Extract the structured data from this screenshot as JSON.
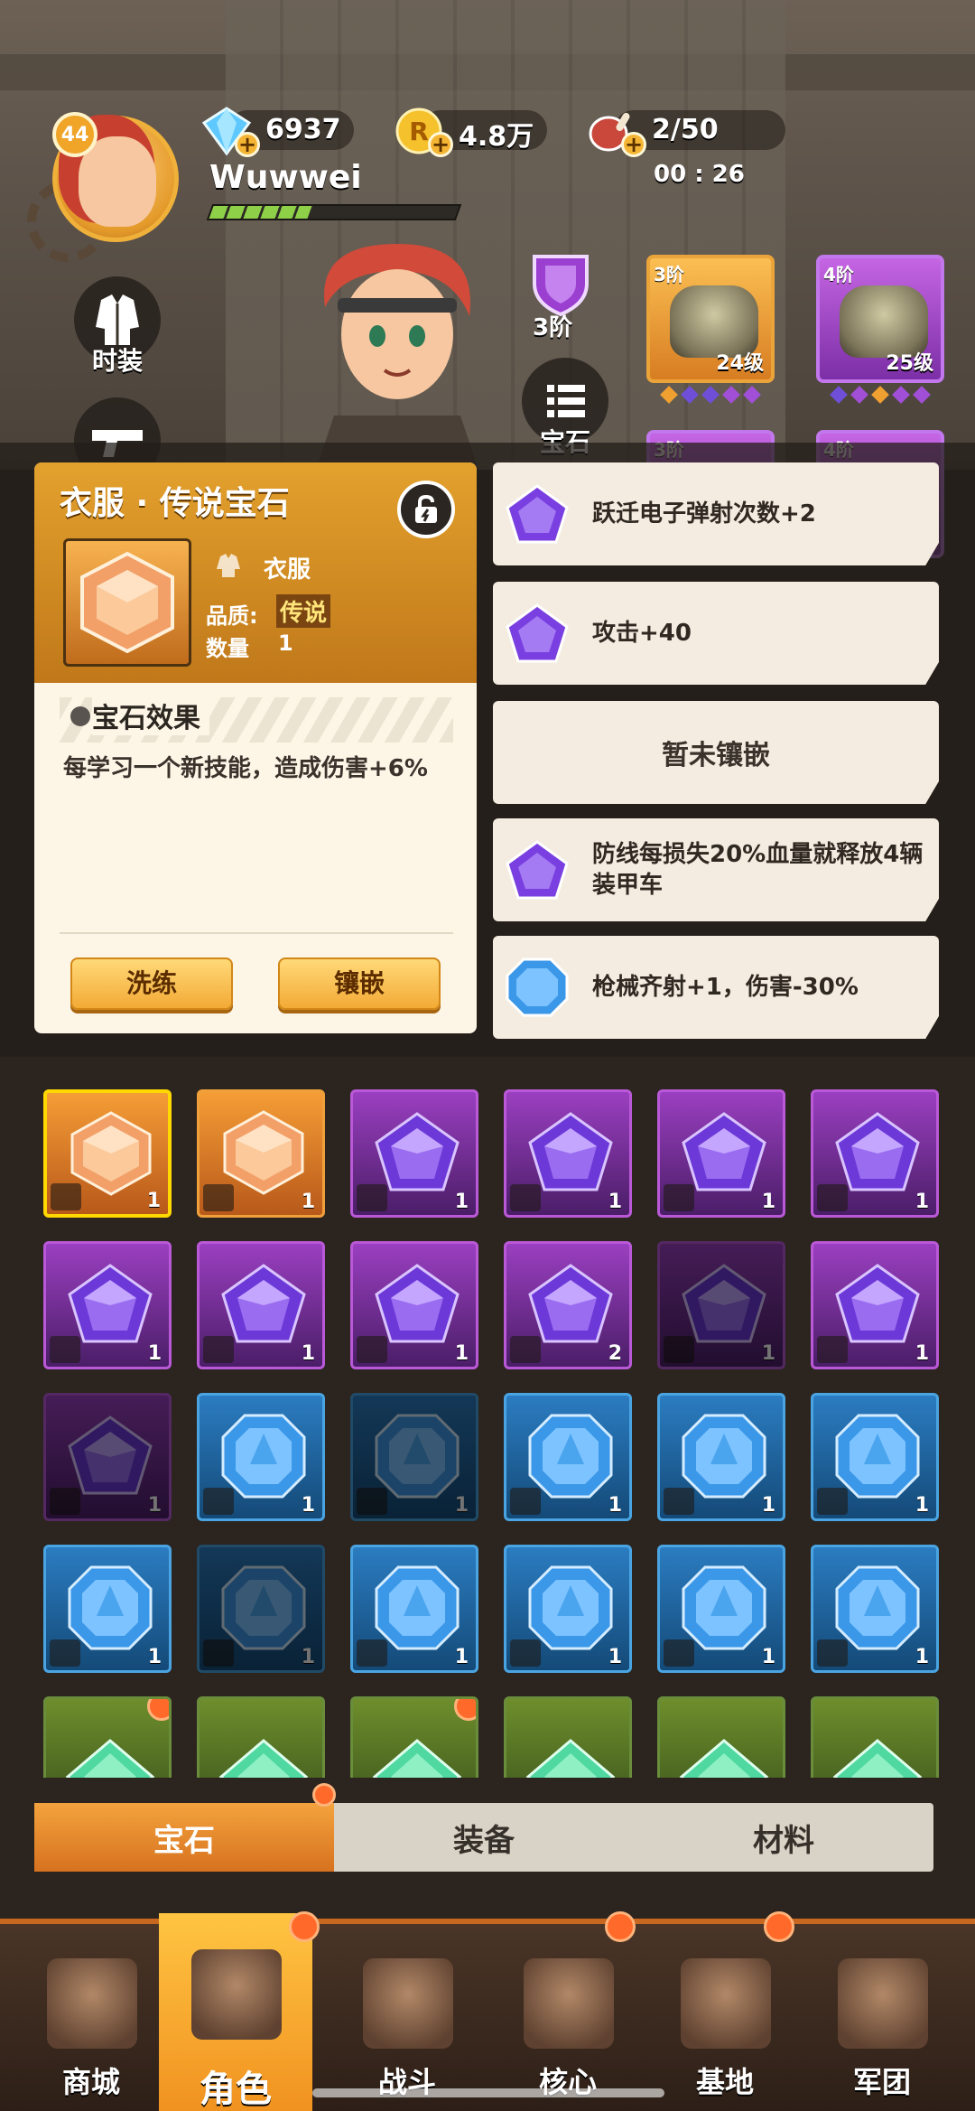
{
  "player": {
    "level": "44",
    "name": "Wuwwei",
    "xp_fraction": 0.4
  },
  "resources": {
    "diamonds": "6937",
    "coins": "4.8万",
    "stamina": "2/50",
    "stamina_timer": "00 : 26"
  },
  "side_buttons": {
    "costume": "时装",
    "gem": "宝石"
  },
  "rank": {
    "label": "3阶"
  },
  "equipment": [
    {
      "tier": "3阶",
      "level": "24级",
      "rarity": "gold"
    },
    {
      "tier": "4阶",
      "level": "25级",
      "rarity": "purple"
    },
    {
      "tier": "3阶",
      "level": "",
      "rarity": "purple"
    },
    {
      "tier": "4阶",
      "level": "",
      "rarity": "purple"
    }
  ],
  "gem_card": {
    "title": "衣服 · 传说宝石",
    "type": "衣服",
    "quality_label": "品质:",
    "quality_value": "传说",
    "count_label": "数量",
    "count_value": "1",
    "effect_title": "宝石效果",
    "effect_text": "每学习一个新技能，造成伤害+6%",
    "buttons": {
      "refine": "洗练",
      "inlay": "镶嵌"
    }
  },
  "socket_slots": [
    {
      "text": "跃迁电子弹射次数+2",
      "gem": "purple"
    },
    {
      "text": "攻击+40",
      "gem": "purple"
    },
    {
      "text": "暂未镶嵌",
      "gem": "none"
    },
    {
      "text": "防线每损失20%血量就释放4辆装甲车",
      "gem": "purple"
    },
    {
      "text": "枪械齐射+1，伤害-30%",
      "gem": "blue"
    }
  ],
  "inventory": [
    {
      "color": "orange",
      "part": "boots",
      "count": "1",
      "selected": true
    },
    {
      "color": "orange",
      "part": "boots",
      "count": "1"
    },
    {
      "color": "purple",
      "part": "boots",
      "count": "1"
    },
    {
      "color": "purple",
      "part": "boots",
      "count": "1"
    },
    {
      "color": "purple",
      "part": "boots",
      "count": "1"
    },
    {
      "color": "purple",
      "part": "boots",
      "count": "1"
    },
    {
      "color": "purple",
      "part": "shoe",
      "count": "1"
    },
    {
      "color": "purple",
      "part": "shoe",
      "count": "1"
    },
    {
      "color": "purple",
      "part": "shoe",
      "count": "1"
    },
    {
      "color": "purple",
      "part": "pants",
      "count": "2"
    },
    {
      "color": "purple",
      "part": "pants",
      "count": "1",
      "dim": true
    },
    {
      "color": "purple",
      "part": "glove",
      "count": "1"
    },
    {
      "color": "purple",
      "part": "glove",
      "count": "1",
      "dim": true
    },
    {
      "color": "blue",
      "part": "helmet",
      "count": "1"
    },
    {
      "color": "blue",
      "part": "helmet",
      "count": "1",
      "dim": true
    },
    {
      "color": "blue",
      "part": "helmet",
      "count": "1"
    },
    {
      "color": "blue",
      "part": "boots",
      "count": "1"
    },
    {
      "color": "blue",
      "part": "boots",
      "count": "1"
    },
    {
      "color": "blue",
      "part": "shoe",
      "count": "1"
    },
    {
      "color": "blue",
      "part": "gun",
      "count": "1",
      "dim": true
    },
    {
      "color": "blue",
      "part": "gun",
      "count": "1"
    },
    {
      "color": "blue",
      "part": "gun",
      "count": "1"
    },
    {
      "color": "blue",
      "part": "gun",
      "count": "1"
    },
    {
      "color": "blue",
      "part": "glove",
      "count": "1"
    },
    {
      "color": "green",
      "part": "",
      "count": "",
      "badge": true
    },
    {
      "color": "green",
      "part": "",
      "count": ""
    },
    {
      "color": "green",
      "part": "",
      "count": "",
      "badge": true
    },
    {
      "color": "green",
      "part": "",
      "count": ""
    },
    {
      "color": "green",
      "part": "",
      "count": ""
    },
    {
      "color": "green",
      "part": "",
      "count": ""
    }
  ],
  "category_tabs": [
    "宝石",
    "装备",
    "材料"
  ],
  "bottom_nav": [
    {
      "label": "商城",
      "badge": false
    },
    {
      "label": "角色",
      "badge": true,
      "active": true
    },
    {
      "label": "战斗",
      "badge": false
    },
    {
      "label": "核心",
      "badge": true
    },
    {
      "label": "基地",
      "badge": true
    },
    {
      "label": "军团",
      "badge": false
    }
  ],
  "colors": {
    "accent": "#f0a030",
    "legend": "#e08a2a",
    "epic": "#9a3fc0",
    "rare": "#2b7cc1"
  }
}
